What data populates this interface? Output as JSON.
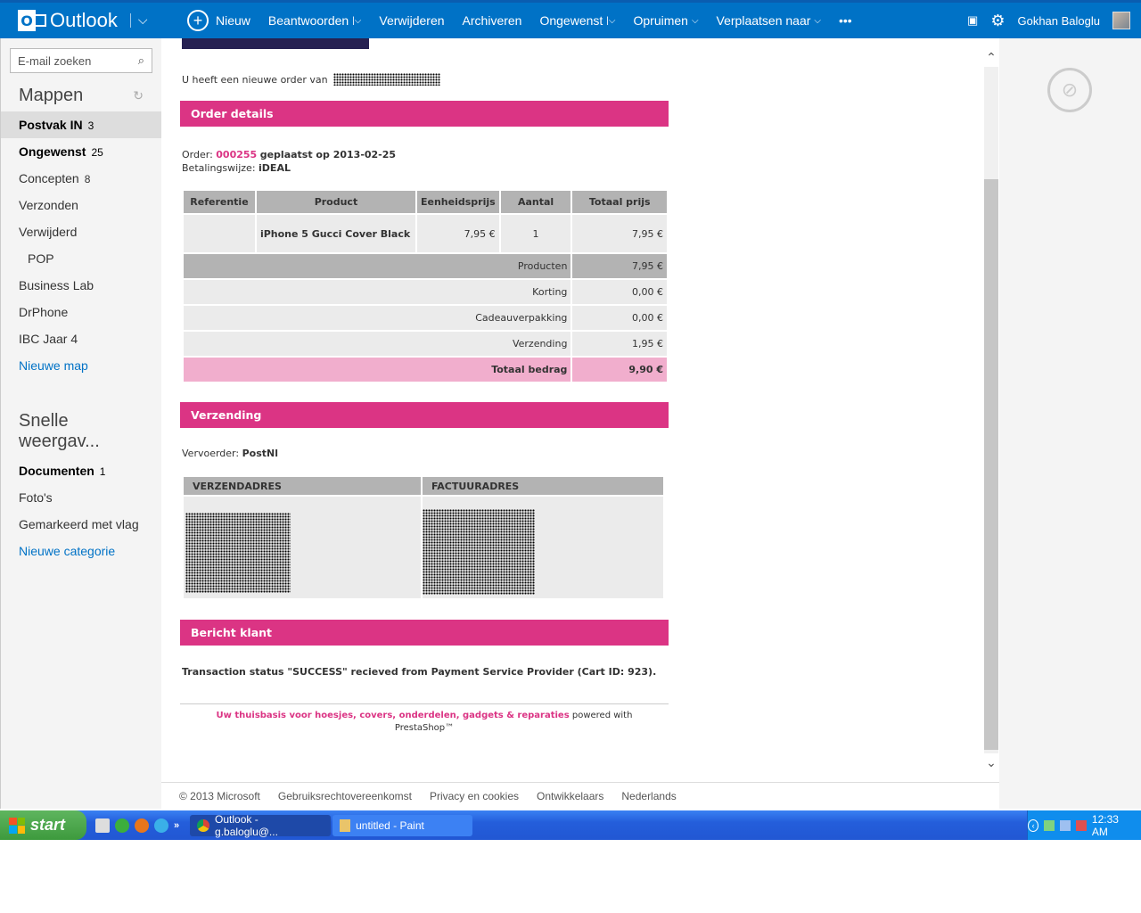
{
  "app": {
    "name": "Outlook"
  },
  "commands": [
    {
      "label": "Nieuw",
      "chevron": false
    },
    {
      "label": "Beantwoorden",
      "chevron": true
    },
    {
      "label": "Verwijderen",
      "chevron": false
    },
    {
      "label": "Archiveren",
      "chevron": false
    },
    {
      "label": "Ongewenst",
      "chevron": true
    },
    {
      "label": "Opruimen",
      "chevron": true
    },
    {
      "label": "Verplaatsen naar",
      "chevron": true
    },
    {
      "label": "•••",
      "chevron": false
    }
  ],
  "user": {
    "name": "Gokhan Baloglu"
  },
  "search": {
    "placeholder": "E-mail zoeken"
  },
  "folders_title": "Mappen",
  "folders": [
    {
      "label": "Postvak IN",
      "count": "3"
    },
    {
      "label": "Ongewenst",
      "count": "25"
    },
    {
      "label": "Concepten",
      "count": "8"
    },
    {
      "label": "Verzonden",
      "count": ""
    },
    {
      "label": "Verwijderd",
      "count": ""
    },
    {
      "label": "POP",
      "count": ""
    },
    {
      "label": "Business Lab",
      "count": ""
    },
    {
      "label": "DrPhone",
      "count": ""
    },
    {
      "label": "IBC Jaar 4",
      "count": ""
    },
    {
      "label": "Nieuwe map",
      "count": ""
    }
  ],
  "quick_title": "Snelle weergav...",
  "quick": [
    {
      "label": "Documenten",
      "count": "1"
    },
    {
      "label": "Foto's",
      "count": ""
    },
    {
      "label": "Gemarkeerd met vlag",
      "count": ""
    },
    {
      "label": "Nieuwe categorie",
      "count": ""
    }
  ],
  "email": {
    "greeting": "U heeft een nieuwe order van",
    "order_details_title": "Order details",
    "order_label": "Order:",
    "order_number": "000255",
    "order_placed": "geplaatst op 2013-02-25",
    "payment_label": "Betalingswijze:",
    "payment_method": "iDEAL",
    "table_headers": [
      "Referentie",
      "Product",
      "Eenheidsprijs",
      "Aantal",
      "Totaal prijs"
    ],
    "item": {
      "reference": "",
      "product": "iPhone 5 Gucci Cover Black",
      "unit_price": "7,95 €",
      "quantity": "1",
      "total": "7,95 €"
    },
    "summary": [
      {
        "label": "Producten",
        "value": "7,95 €"
      },
      {
        "label": "Korting",
        "value": "0,00 €"
      },
      {
        "label": "Cadeauverpakking",
        "value": "0,00 €"
      },
      {
        "label": "Verzending",
        "value": "1,95 €"
      }
    ],
    "total": {
      "label": "Totaal bedrag",
      "value": "9,90 €"
    },
    "shipping_title": "Verzending",
    "carrier_label": "Vervoerder:",
    "carrier": "PostNl",
    "address_headers": [
      "VERZENDADRES",
      "FACTUURADRES"
    ],
    "message_title": "Bericht klant",
    "message": "Transaction status \"SUCCESS\" recieved from Payment Service Provider (Cart ID: 923).",
    "footer_tagline": "Uw thuisbasis voor hoesjes, covers, onderdelen, gadgets & reparaties",
    "footer_powered": "powered with",
    "footer_brand": "PrestaShop™"
  },
  "footer_links": [
    "© 2013 Microsoft",
    "Gebruiksrechtovereenkomst",
    "Privacy en cookies",
    "Ontwikkelaars",
    "Nederlands"
  ],
  "taskbar": {
    "start": "start",
    "tasks": [
      "Outlook - g.baloglu@...",
      "untitled - Paint"
    ],
    "clock": "12:33 AM"
  },
  "colors": {
    "accent": "#0072c6",
    "email_pink": "#db3484"
  }
}
